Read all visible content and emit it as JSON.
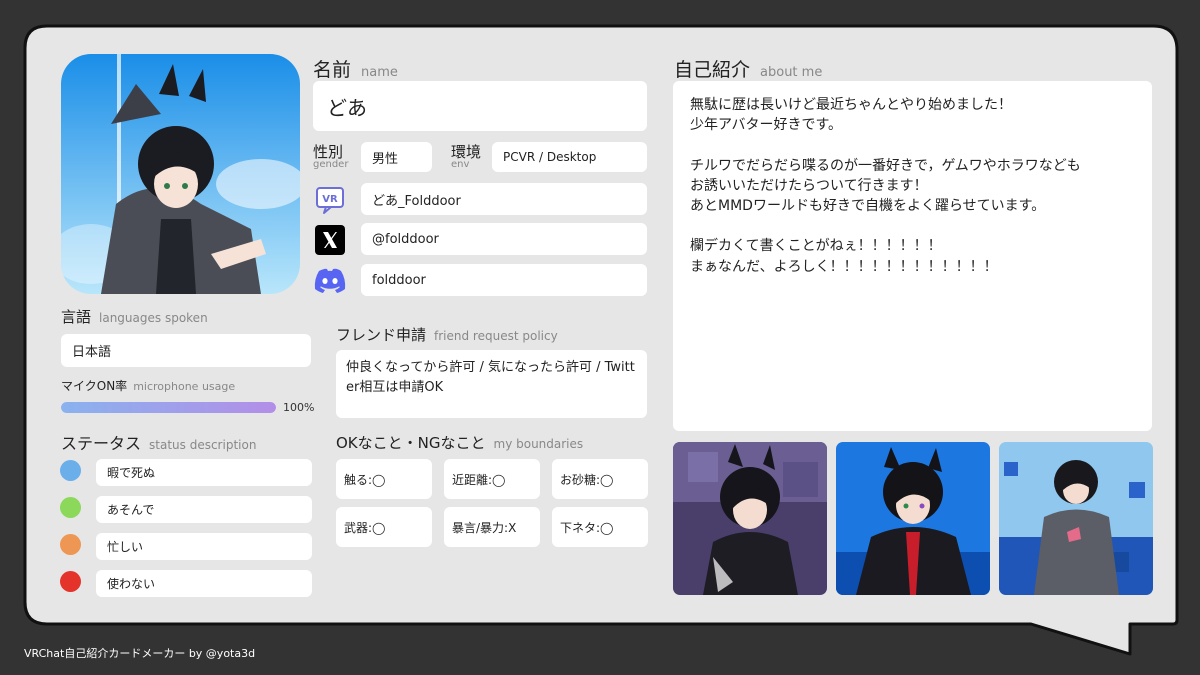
{
  "profile": {
    "name_label": "名前",
    "name_sub": "name",
    "name_value": "どあ",
    "gender_label": "性別",
    "gender_sub": "gender",
    "gender_value": "男性",
    "env_label": "環境",
    "env_sub": "env",
    "env_value": "PCVR / Desktop"
  },
  "socials": {
    "vrchat": {
      "icon": "vrchat-icon",
      "value": "どあ_Folddoor"
    },
    "x": {
      "icon": "x-icon",
      "value": "@folddoor"
    },
    "discord": {
      "icon": "discord-icon",
      "value": "folddoor"
    }
  },
  "languages": {
    "label": "言語",
    "sub": "languages spoken",
    "value": "日本語"
  },
  "mic": {
    "label": "マイクON率",
    "sub": "microphone usage",
    "percent": 100,
    "percent_text": "100%"
  },
  "status": {
    "label": "ステータス",
    "sub": "status description",
    "items": [
      {
        "color": "#6aaeea",
        "text": "暇で死ぬ"
      },
      {
        "color": "#8bd85a",
        "text": "あそんで"
      },
      {
        "color": "#ee9654",
        "text": "忙しい"
      },
      {
        "color": "#e4332b",
        "text": "使わない"
      }
    ]
  },
  "friend_request": {
    "label": "フレンド申請",
    "sub": "friend request policy",
    "text": "仲良くなってから許可 / 気になったら許可 / Twitter相互は申請OK"
  },
  "boundaries": {
    "label": "OKなこと・NGなこと",
    "sub": "my boundaries",
    "items": [
      "触る:◯",
      "近距離:◯",
      "お砂糖:◯",
      "武器:◯",
      "暴言/暴力:X",
      "下ネタ:◯"
    ]
  },
  "about": {
    "label": "自己紹介",
    "sub": "about me",
    "text": "無駄に歴は長いけど最近ちゃんとやり始めました！\n少年アバター好きです。\n\nチルワでだらだら喋るのが一番好きで，ゲムワやホラワなども\nお誘いいただけたらついて行きます！\nあとMMDワールドも好きで自機をよく躍らせています。\n\n欄デカくて書くことがねぇ！！！！！！\nまぁなんだ、よろしく！！！！！！！！！！！！"
  },
  "colors": {
    "background": "#333333",
    "card": "#e6e6e6",
    "mic_gradient_start": "#8ab2ee",
    "mic_gradient_end": "#b38ee8",
    "discord": "#5865f2",
    "vrchat": "#6b6fd6"
  },
  "footer": "VRChat自己紹介カードメーカー by @yota3d"
}
